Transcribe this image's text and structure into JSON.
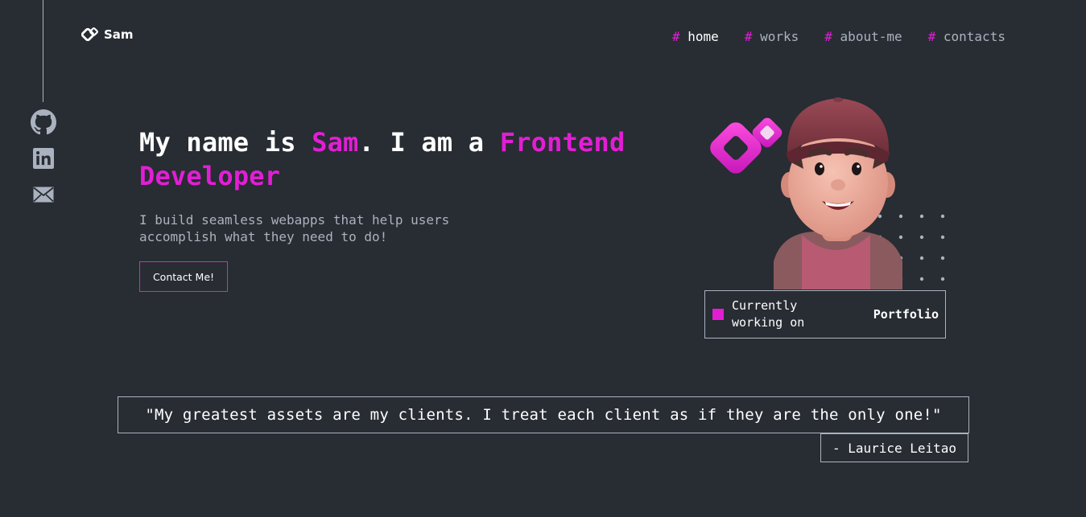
{
  "brand": {
    "name": "Sam",
    "logo_icon": "sam-logo-icon"
  },
  "nav": {
    "hash": "#",
    "items": [
      {
        "label": "home",
        "active": true
      },
      {
        "label": "works",
        "active": false
      },
      {
        "label": "about-me",
        "active": false
      },
      {
        "label": "contacts",
        "active": false
      }
    ]
  },
  "social": [
    {
      "icon": "github-icon"
    },
    {
      "icon": "linkedin-icon"
    },
    {
      "icon": "email-icon"
    }
  ],
  "hero": {
    "title_part1": "My name is ",
    "name": "Sam",
    "title_part2": ". I am a ",
    "role": "Frontend Developer",
    "subtitle": "I build seamless webapps that help users accomplish what they need to do!",
    "cta_label": "Contact Me!"
  },
  "status": {
    "label": "Currently working on",
    "project": "Portfolio"
  },
  "quote": {
    "text": "\"My greatest assets are my clients. I treat each client as if they are the only one!\"",
    "author": "- Laurice Leitao"
  },
  "colors": {
    "background": "#282c33",
    "accent": "#e21ed5",
    "muted": "#abb2bf",
    "text": "#ffffff"
  }
}
